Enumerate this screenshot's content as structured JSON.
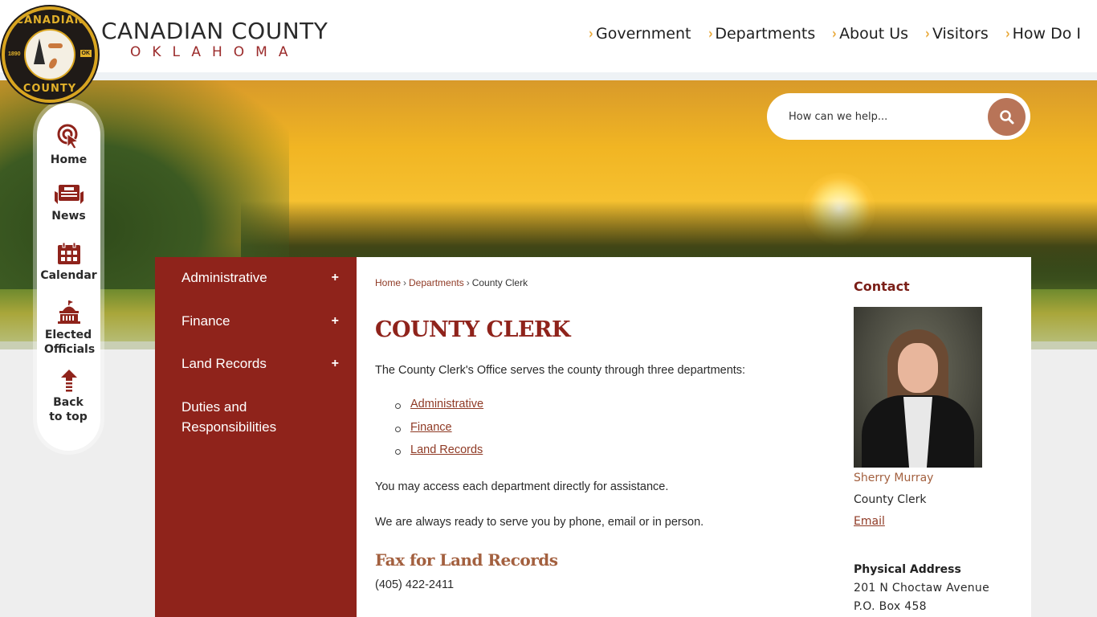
{
  "header": {
    "logo": {
      "seal_top": "CANADIAN",
      "seal_bottom": "COUNTY",
      "seal_year": "1890",
      "seal_state": "OK",
      "title": "CANADIAN COUNTY",
      "subtitle": "OKLAHOMA"
    },
    "nav": [
      {
        "label": "Government",
        "icon": "chevron-right-icon"
      },
      {
        "label": "Departments",
        "icon": "chevron-right-icon"
      },
      {
        "label": "About Us",
        "icon": "chevron-right-icon"
      },
      {
        "label": "Visitors",
        "icon": "chevron-right-icon"
      },
      {
        "label": "How Do I",
        "icon": "chevron-right-icon"
      }
    ],
    "chevron_glyph": "›"
  },
  "search": {
    "placeholder": "How can we help...",
    "button_icon": "search-icon"
  },
  "quick_links": [
    {
      "label": "Home",
      "icon": "pointer-click-icon"
    },
    {
      "label": "News",
      "icon": "newspaper-icon"
    },
    {
      "label": "Calendar",
      "icon": "calendar-icon"
    },
    {
      "label": "Elected Officials",
      "icon": "capitol-building-icon"
    },
    {
      "label": "Back to top",
      "icon": "arrow-up-icon"
    }
  ],
  "side_nav": {
    "items": [
      {
        "label": "Administrative",
        "expandable": true
      },
      {
        "label": "Finance",
        "expandable": true
      },
      {
        "label": "Land Records",
        "expandable": true
      },
      {
        "label": "Duties and Responsibilities",
        "expandable": false
      }
    ],
    "expand_glyph": "+"
  },
  "breadcrumb": {
    "items": [
      "Home",
      "Departments"
    ],
    "current": "County Clerk",
    "separator": "›"
  },
  "main": {
    "title": "COUNTY CLERK",
    "intro": "The County Clerk's Office serves the county through three departments:",
    "departments": [
      "Administrative",
      "Finance",
      "Land Records"
    ],
    "para_access": "You may access each department directly for assistance.",
    "para_ready": "We are always ready to serve you by phone, email or in person.",
    "fax_heading": "Fax for Land Records",
    "fax_number": "(405) 422-2411"
  },
  "contact": {
    "heading": "Contact",
    "name": "Sherry Murray",
    "role": "County Clerk",
    "email_label": "Email",
    "address_label": "Physical Address",
    "address_lines": [
      "201 N Choctaw Avenue",
      "P.O. Box 458"
    ]
  },
  "colors": {
    "brand_red": "#8f231b",
    "accent_orange": "#e8a531",
    "link_brown": "#8f3a25",
    "search_button": "#b87458"
  }
}
